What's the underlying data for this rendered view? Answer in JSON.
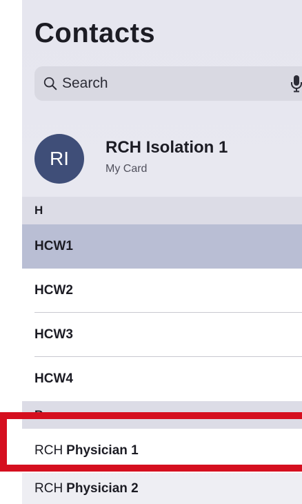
{
  "header": {
    "title": "Contacts"
  },
  "search": {
    "placeholder": "Search"
  },
  "my_card": {
    "initials": "RI",
    "name": "RCH Isolation 1",
    "subtitle": "My Card",
    "avatar_color": "#3f4e78"
  },
  "sections": [
    {
      "letter": "H",
      "contacts": [
        {
          "name": "HCW1",
          "selected": true
        },
        {
          "name": "HCW2",
          "selected": false
        },
        {
          "name": "HCW3",
          "selected": false
        },
        {
          "name": "HCW4",
          "selected": false
        }
      ]
    },
    {
      "letter": "R",
      "contacts": [
        {
          "prefix": "RCH",
          "name": "Physician 1"
        },
        {
          "prefix": "RCH",
          "name": "Physician 2"
        }
      ]
    }
  ],
  "colors": {
    "selected_row": "#b9bed4",
    "highlight_annotation": "#d50f1f",
    "section_header": "#dcdce6"
  },
  "icons": {
    "search": "search-icon",
    "mic": "mic-icon"
  }
}
